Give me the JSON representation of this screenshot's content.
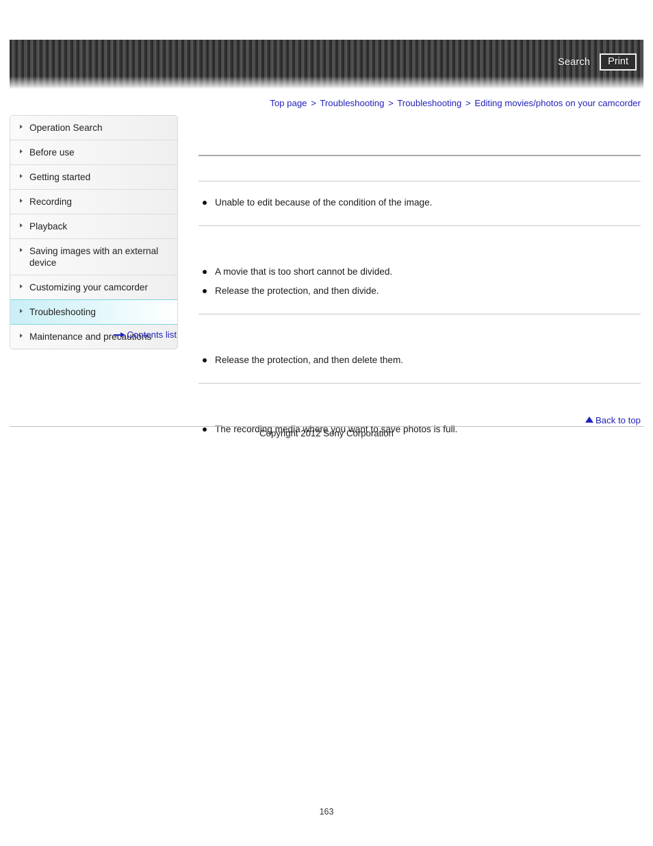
{
  "header": {
    "search_label": "Search",
    "print_label": "Print"
  },
  "breadcrumb": {
    "separator": ">",
    "items": [
      {
        "label": "Top page"
      },
      {
        "label": "Troubleshooting"
      },
      {
        "label": "Troubleshooting"
      },
      {
        "label": "Editing movies/photos on your camcorder"
      }
    ]
  },
  "sidebar": {
    "items": [
      {
        "label": "Operation Search",
        "active": false
      },
      {
        "label": "Before use",
        "active": false
      },
      {
        "label": "Getting started",
        "active": false
      },
      {
        "label": "Recording",
        "active": false
      },
      {
        "label": "Playback",
        "active": false
      },
      {
        "label": "Saving images with an external device",
        "active": false
      },
      {
        "label": "Customizing your camcorder",
        "active": false
      },
      {
        "label": "Troubleshooting",
        "active": true
      },
      {
        "label": "Maintenance and precautions",
        "active": false
      }
    ],
    "contents_list_label": "Contents list"
  },
  "content": {
    "page_heading": "",
    "sections": [
      {
        "heading": "",
        "bullets": [
          "Unable to edit because of the condition of the image."
        ]
      },
      {
        "heading": "",
        "bullets": [
          "A movie that is too short cannot be divided.",
          "Release the protection, and then divide."
        ]
      },
      {
        "heading": "",
        "bullets": [
          "Release the protection, and then delete them."
        ]
      },
      {
        "heading": "",
        "bullets": [
          "The recording media where you want to save photos is full."
        ]
      }
    ]
  },
  "footer": {
    "back_to_top_label": "Back to top",
    "copyright": "Copyright 2012 Sony Corporation",
    "page_number": "163"
  }
}
